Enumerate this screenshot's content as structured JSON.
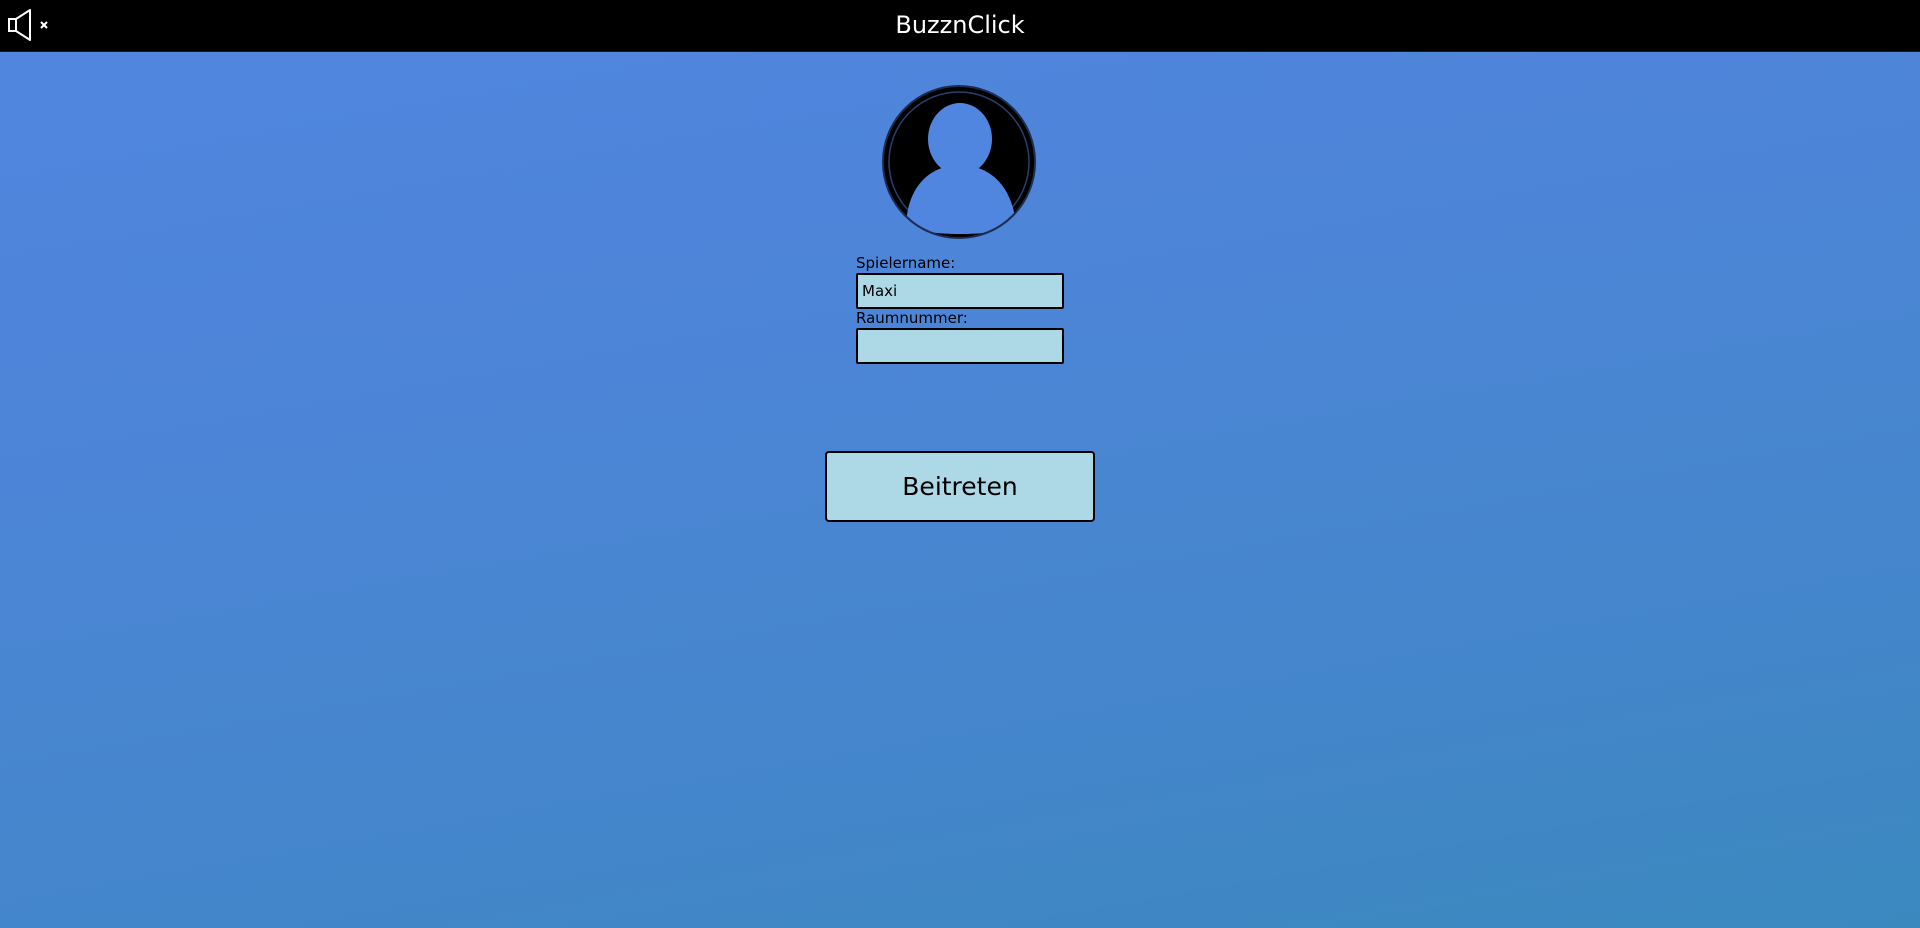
{
  "header": {
    "title": "BuzznClick",
    "mute_icon": "speaker-muted-icon"
  },
  "avatar": {
    "icon": "user-silhouette-icon"
  },
  "form": {
    "player_name": {
      "label": "Spielername:",
      "value": "Maxi",
      "placeholder": ""
    },
    "room_number": {
      "label": "Raumnummer:",
      "value": "",
      "placeholder": ""
    },
    "join_label": "Beitreten"
  },
  "colors": {
    "header_bg": "#000000",
    "field_bg": "#add8e6",
    "background_top": "#5186e0",
    "background_bottom": "#3b88bf"
  }
}
